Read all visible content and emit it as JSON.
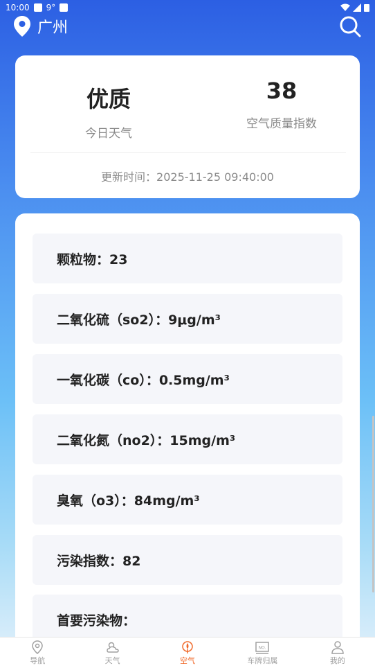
{
  "status_bar": {
    "time": "10:00",
    "temp": "9°"
  },
  "header": {
    "city": "广州"
  },
  "summary": {
    "quality": "优质",
    "quality_label": "今日天气",
    "aqi": "38",
    "aqi_label": "空气质量指数",
    "update_time": "更新时间：2025-11-25 09:40:00"
  },
  "items": [
    "颗粒物：23",
    "二氧化硫（so2）：9μg/m³",
    "一氧化碳（co）：0.5mg/m³",
    "二氧化氮（no2）：15mg/m³",
    "臭氧（o3）：84mg/m³",
    "污染指数：82",
    "首要污染物："
  ],
  "tabs": [
    {
      "label": "导航",
      "icon": "location-pin-icon"
    },
    {
      "label": "天气",
      "icon": "weather-icon"
    },
    {
      "label": "空气",
      "icon": "air-icon"
    },
    {
      "label": "车牌归属",
      "icon": "license-plate-icon"
    },
    {
      "label": "我的",
      "icon": "user-icon"
    }
  ],
  "colors": {
    "accent": "#f06a2b",
    "header_blue": "#2c5fe3"
  }
}
